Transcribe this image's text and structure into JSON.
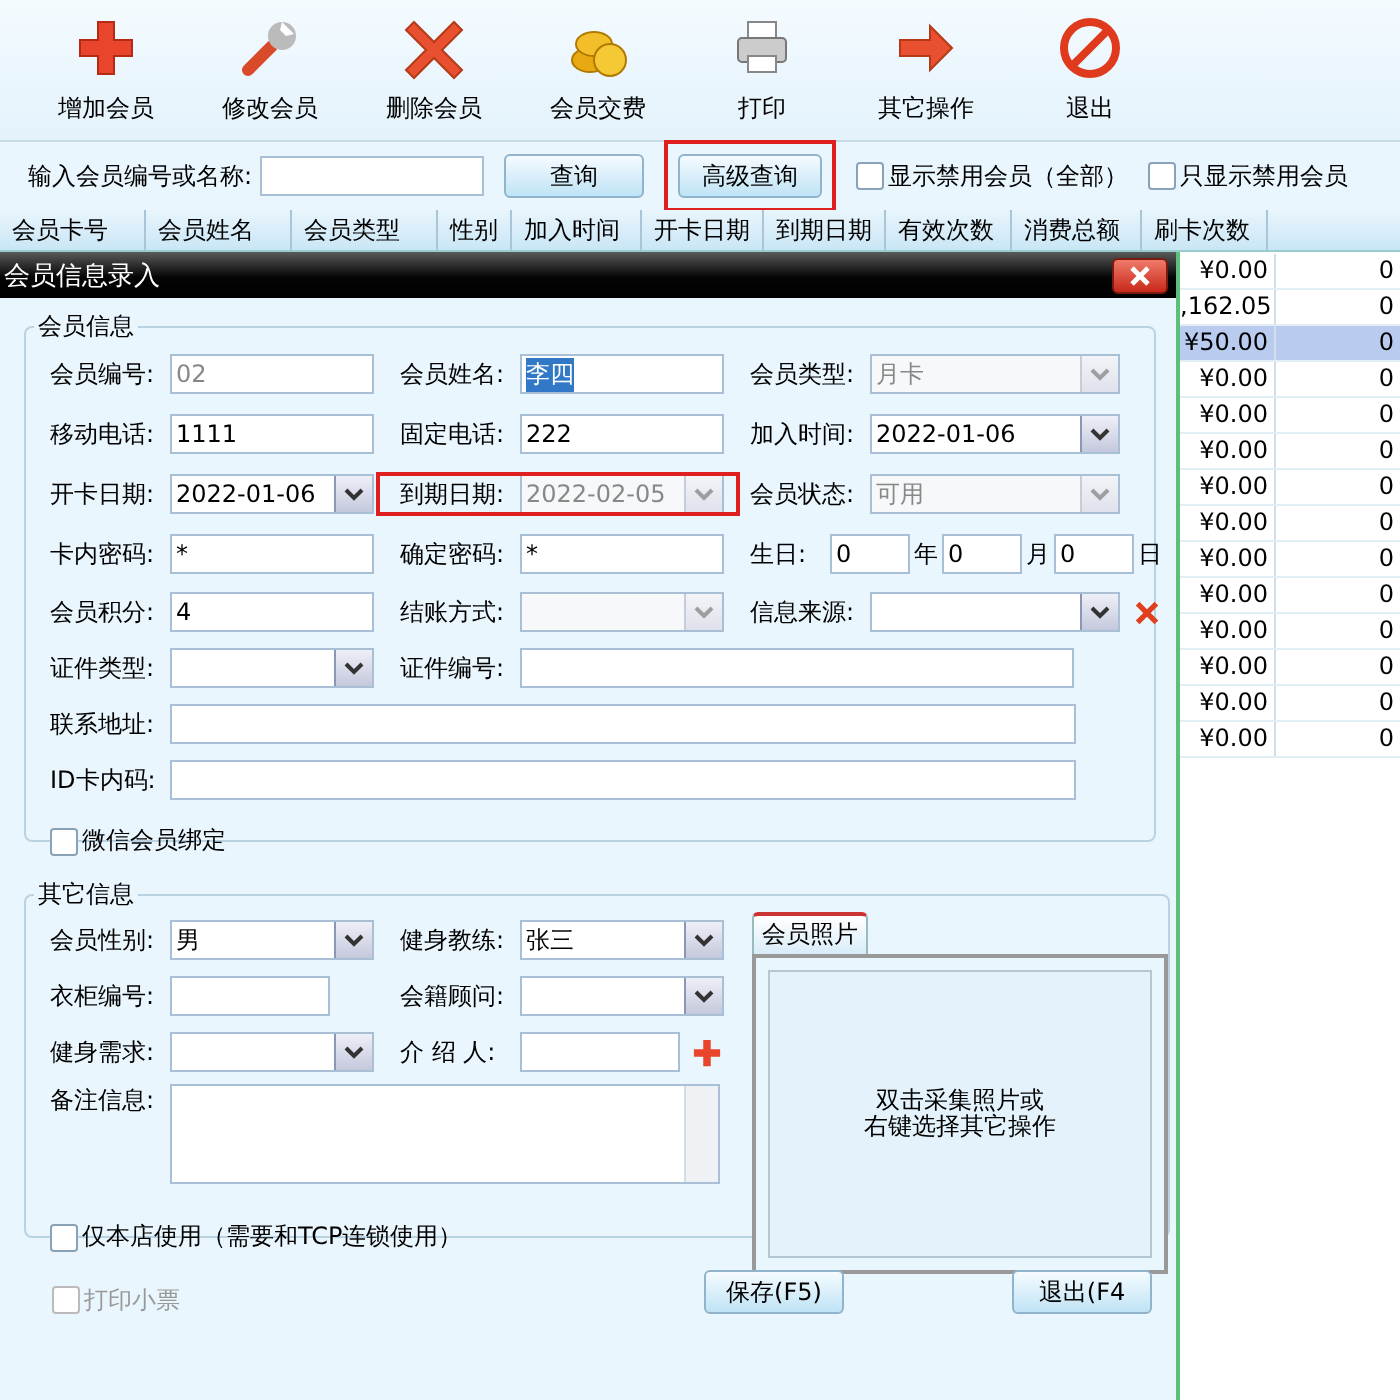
{
  "toolbar": [
    {
      "kind": "plus",
      "label": "增加会员"
    },
    {
      "kind": "wrench",
      "label": "修改会员"
    },
    {
      "kind": "cross",
      "label": "删除会员"
    },
    {
      "kind": "coins",
      "label": "会员交费"
    },
    {
      "kind": "printer",
      "label": "打印"
    },
    {
      "kind": "arrow",
      "label": "其它操作"
    },
    {
      "kind": "stop",
      "label": "退出"
    }
  ],
  "search": {
    "label": "输入会员编号或名称:",
    "query_button": "查询",
    "advanced_button": {
      "label": "高级查询",
      "highlighted": true
    },
    "checkboxes": [
      {
        "label": "显示禁用会员（全部）",
        "checked": false
      },
      {
        "label": "只显示禁用会员",
        "checked": false
      }
    ]
  },
  "table": {
    "columns": [
      "会员卡号",
      "会员姓名",
      "会员类型",
      "性别",
      "加入时间",
      "开卡日期",
      "到期日期",
      "有效次数",
      "消费总额",
      "刷卡次数"
    ],
    "rows": [
      {
        "total": "¥0.00",
        "count": "0",
        "selected": false
      },
      {
        "total": ",162.05",
        "count": "0",
        "selected": false
      },
      {
        "total": "¥50.00",
        "count": "0",
        "selected": true
      },
      {
        "total": "¥0.00",
        "count": "0",
        "selected": false
      },
      {
        "total": "¥0.00",
        "count": "0",
        "selected": false
      },
      {
        "total": "¥0.00",
        "count": "0",
        "selected": false
      },
      {
        "total": "¥0.00",
        "count": "0",
        "selected": false
      },
      {
        "total": "¥0.00",
        "count": "0",
        "selected": false
      },
      {
        "total": "¥0.00",
        "count": "0",
        "selected": false
      },
      {
        "total": "¥0.00",
        "count": "0",
        "selected": false
      },
      {
        "total": "¥0.00",
        "count": "0",
        "selected": false
      },
      {
        "total": "¥0.00",
        "count": "0",
        "selected": false
      },
      {
        "total": "¥0.00",
        "count": "0",
        "selected": false
      },
      {
        "total": "¥0.00",
        "count": "0",
        "selected": false
      }
    ]
  },
  "dialog": {
    "title": "会员信息录入",
    "member_section": {
      "legend": "会员信息",
      "rows": [
        [
          {
            "kind": "text",
            "label": "会员编号:",
            "value": "02",
            "disabled": true
          },
          {
            "kind": "text",
            "label": "会员姓名:",
            "value": "李四",
            "value_selected": true
          },
          {
            "kind": "select",
            "label": "会员类型:",
            "value": "月卡",
            "disabled": true
          }
        ],
        [
          {
            "kind": "text",
            "label": "移动电话:",
            "value": "1111"
          },
          {
            "kind": "text",
            "label": "固定电话:",
            "value": "222"
          },
          {
            "kind": "select",
            "label": "加入时间:",
            "value": "2022-01-06"
          }
        ],
        [
          {
            "kind": "select",
            "label": "开卡日期:",
            "value": "2022-01-06"
          },
          {
            "kind": "select",
            "label": "到期日期:",
            "value": "2022-02-05",
            "disabled": true,
            "highlighted": true
          },
          {
            "kind": "select",
            "label": "会员状态:",
            "value": "可用",
            "disabled": true
          }
        ],
        [
          {
            "kind": "text",
            "label": "卡内密码:",
            "value": "*"
          },
          {
            "kind": "text",
            "label": "确定密码:",
            "value": "*"
          },
          {
            "kind": "birthday",
            "label": "生日:",
            "parts": [
              {
                "value": "0",
                "unit": "年"
              },
              {
                "value": "0",
                "unit": "月"
              },
              {
                "value": "0",
                "unit": "日"
              }
            ]
          }
        ],
        [
          {
            "kind": "text",
            "label": "会员积分:",
            "value": "4"
          },
          {
            "kind": "select",
            "label": "结账方式:",
            "disabled": true
          },
          {
            "kind": "select_delete",
            "label": "信息来源:"
          }
        ],
        [
          {
            "kind": "select",
            "label": "证件类型:"
          },
          {
            "kind": "wide",
            "label": "证件编号:"
          }
        ],
        [
          {
            "kind": "full",
            "label": "联系地址:"
          }
        ],
        [
          {
            "kind": "full",
            "label": "ID卡内码:"
          }
        ]
      ],
      "checkbox": {
        "label": "微信会员绑定",
        "checked": false
      }
    },
    "other_section": {
      "legend": "其它信息",
      "rows": [
        [
          {
            "kind": "select",
            "label": "会员性别:",
            "value": "男"
          },
          {
            "kind": "select",
            "label": "健身教练:",
            "value": "张三"
          }
        ],
        [
          {
            "kind": "short",
            "label": "衣柜编号:"
          },
          {
            "kind": "select",
            "label": "会籍顾问:"
          }
        ],
        [
          {
            "kind": "select",
            "label": "健身需求:"
          },
          {
            "kind": "text_add",
            "label": "介 绍 人:"
          }
        ],
        [
          {
            "kind": "textarea",
            "label": "备注信息:"
          }
        ]
      ],
      "checkbox": {
        "label": "仅本店使用（需要和TCP连锁使用）",
        "checked": false
      },
      "photo": {
        "tab": "会员照片",
        "hint_lines": [
          "双击采集照片或",
          "右键选择其它操作"
        ]
      }
    },
    "print_checkbox": {
      "label": "打印小票",
      "checked": false,
      "disabled": true
    },
    "save_button": "保存(F5)",
    "exit_button": "退出(F4"
  }
}
